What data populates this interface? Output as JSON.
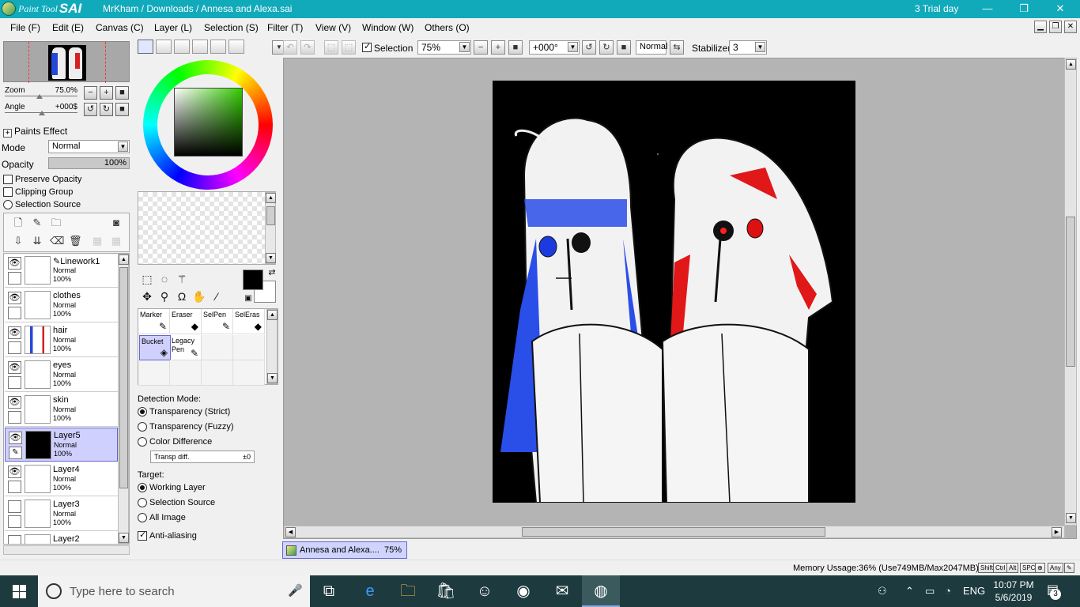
{
  "titlebar": {
    "brand_small": "Paint Tool",
    "brand_large": "SAI",
    "path": "MrKham / Downloads / Annesa and Alexa.sai",
    "trial": "3 Trial day",
    "minimize": "—",
    "restore": "❐",
    "close": "✕"
  },
  "menu": [
    "File (F)",
    "Edit (E)",
    "Canvas (C)",
    "Layer (L)",
    "Selection (S)",
    "Filter (T)",
    "View (V)",
    "Window (W)",
    "Others (O)"
  ],
  "navigator": {
    "zoom_label": "Zoom",
    "zoom_value": "75.0%",
    "angle_label": "Angle",
    "angle_value": "+000$"
  },
  "layer_props": {
    "paints_effect": "Paints Effect",
    "mode_label": "Mode",
    "mode_value": "Normal",
    "opacity_label": "Opacity",
    "opacity_value": "100%",
    "opacity_fraction": 1.0,
    "preserve_opacity": "Preserve Opacity",
    "clipping_group": "Clipping Group",
    "selection_source": "Selection Source"
  },
  "layers": [
    {
      "name": "Linework1",
      "mode": "Normal",
      "opacity": "100%",
      "visible": true,
      "selected": false
    },
    {
      "name": "clothes",
      "mode": "Normal",
      "opacity": "100%",
      "visible": true,
      "selected": false
    },
    {
      "name": "hair",
      "mode": "Normal",
      "opacity": "100%",
      "visible": true,
      "selected": false
    },
    {
      "name": "eyes",
      "mode": "Normal",
      "opacity": "100%",
      "visible": true,
      "selected": false
    },
    {
      "name": "skin",
      "mode": "Normal",
      "opacity": "100%",
      "visible": true,
      "selected": false
    },
    {
      "name": "Layer5",
      "mode": "Normal",
      "opacity": "100%",
      "visible": true,
      "selected": true
    },
    {
      "name": "Layer4",
      "mode": "Normal",
      "opacity": "100%",
      "visible": true,
      "selected": false
    },
    {
      "name": "Layer3",
      "mode": "Normal",
      "opacity": "100%",
      "visible": false,
      "selected": false
    },
    {
      "name": "Layer2",
      "mode": "",
      "opacity": "",
      "visible": false,
      "selected": false
    }
  ],
  "brushes": [
    {
      "name": "Marker",
      "icon": "✎"
    },
    {
      "name": "Eraser",
      "icon": "◆"
    },
    {
      "name": "SelPen",
      "icon": "✎"
    },
    {
      "name": "SelEras",
      "icon": "◆"
    },
    {
      "name": "Bucket",
      "icon": "◈"
    },
    {
      "name": "Legacy Pen",
      "icon": "✎"
    }
  ],
  "bucket_options": {
    "detection_mode_label": "Detection Mode:",
    "transparency_strict": "Transparency (Strict)",
    "transparency_fuzzy": "Transparency (Fuzzy)",
    "color_difference": "Color Difference",
    "transp_diff_label": "Transp diff.",
    "transp_diff_value": "±0",
    "target_label": "Target:",
    "working_layer": "Working Layer",
    "selection_source": "Selection Source",
    "all_image": "All Image",
    "anti_aliasing": "Anti-aliasing"
  },
  "canvasbar": {
    "selection_label": "Selection",
    "zoom": "75%",
    "angle": "+000°",
    "blend": "Normal",
    "stabilizer_label": "Stabilizer",
    "stabilizer_value": "3"
  },
  "doc_tab": {
    "name": "Annesa and Alexa....",
    "zoom": "75%"
  },
  "status": {
    "memory": "Memory Ussage:36% (Use749MB/Max2047MB)",
    "keys": [
      "Shift",
      "Ctrl",
      "Alt",
      "SPC",
      "⊕",
      "Any",
      "✎"
    ]
  },
  "taskbar": {
    "search_placeholder": "Type here to search",
    "language": "ENG",
    "time": "10:07 PM",
    "date": "5/6/2019",
    "notifications": "3"
  },
  "colors": {
    "titlebar": "#11aabb",
    "selected_layer": "#d0d0ff",
    "canvas_bg": "#b4b4b4",
    "taskbar": "#1d3a3e",
    "foreground": "#000000",
    "background": "#ffffff"
  }
}
